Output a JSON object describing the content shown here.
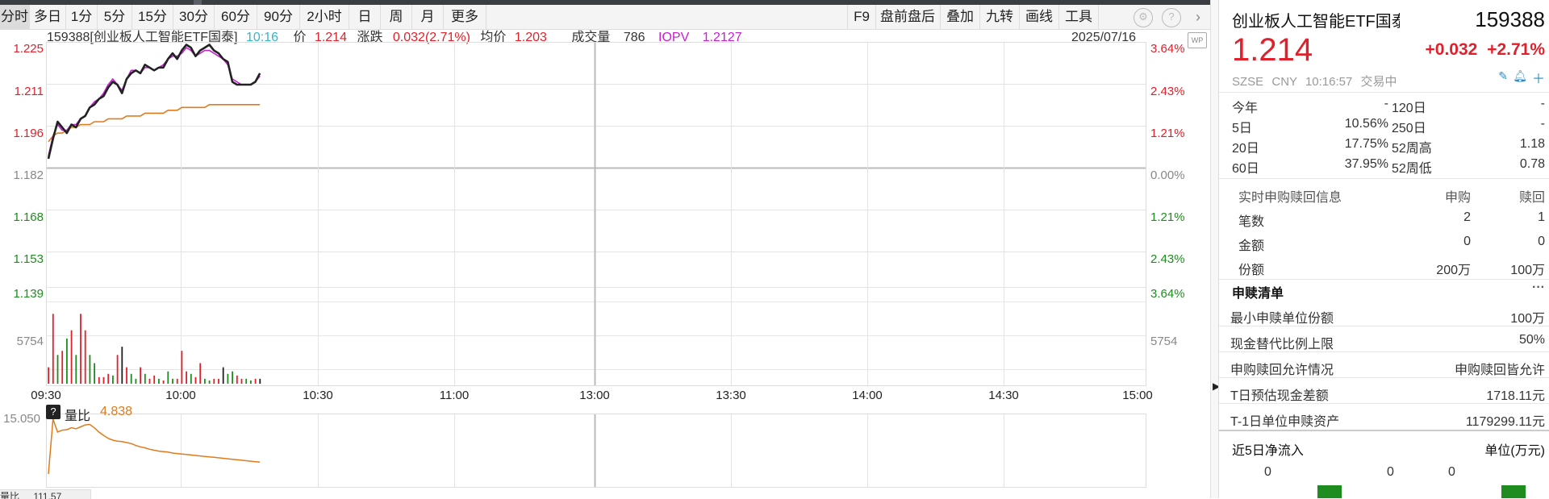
{
  "toolbar": {
    "tabs": [
      "分时",
      "多日",
      "1分",
      "5分",
      "15分",
      "30分",
      "60分",
      "90分",
      "2小时",
      "日",
      "周",
      "月",
      "更多"
    ],
    "active_tab": "分时",
    "right_buttons": [
      "F9",
      "盘前盘后",
      "叠加",
      "九转",
      "画线",
      "工具"
    ],
    "icons": [
      "gear-icon",
      "help-icon",
      "chevron-right-icon"
    ]
  },
  "info": {
    "code_name": "159388[创业板人工智能ETF国泰]",
    "time": "10:16",
    "price_label": "价",
    "price": "1.214",
    "change_label": "涨跌",
    "change": "0.032(2.71%)",
    "avg_label": "均价",
    "avg": "1.203",
    "volume_label": "成交量",
    "volume": "786",
    "iopv_label": "IOPV",
    "iopv": "1.2127",
    "date": "2025/07/16",
    "wp_icon": "WP"
  },
  "chart_data": {
    "type": "line",
    "title": "",
    "price_axis_left": [
      "1.225",
      "1.211",
      "1.196",
      "1.182",
      "1.168",
      "1.153",
      "1.139"
    ],
    "price_axis_right": [
      "3.64%",
      "2.43%",
      "1.21%",
      "0.00%",
      "1.21%",
      "2.43%",
      "3.64%"
    ],
    "volume_axis": "5754",
    "x_ticks": [
      "09:30",
      "10:00",
      "10:30",
      "11:00",
      "13:00",
      "13:30",
      "14:00",
      "14:30",
      "15:00"
    ],
    "ylim": [
      1.139,
      1.225
    ],
    "prev_close": 1.182,
    "series": [
      {
        "name": "价",
        "color": "#222222",
        "x": [
          0,
          1,
          2,
          3,
          4,
          5,
          6,
          7,
          8,
          9,
          10,
          11,
          12,
          13,
          14,
          15,
          16,
          17,
          18,
          19,
          20,
          21,
          22,
          23,
          24,
          25,
          26,
          27,
          28,
          29,
          30,
          31,
          32,
          33,
          34,
          35,
          36,
          37,
          38,
          39,
          40,
          41,
          42,
          43,
          44,
          45,
          46
        ],
        "values": [
          1.184,
          1.191,
          1.197,
          1.195,
          1.193,
          1.196,
          1.195,
          1.198,
          1.199,
          1.202,
          1.203,
          1.205,
          1.206,
          1.209,
          1.211,
          1.21,
          1.207,
          1.212,
          1.214,
          1.215,
          1.214,
          1.217,
          1.216,
          1.215,
          1.216,
          1.216,
          1.219,
          1.221,
          1.219,
          1.222,
          1.224,
          1.223,
          1.22,
          1.222,
          1.223,
          1.224,
          1.222,
          1.221,
          1.219,
          1.218,
          1.211,
          1.21,
          1.21,
          1.21,
          1.21,
          1.211,
          1.214
        ]
      },
      {
        "name": "IOPV",
        "color": "#c61ed1",
        "x": [
          0,
          1,
          2,
          3,
          4,
          5,
          6,
          7,
          8,
          9,
          10,
          11,
          12,
          13,
          14,
          15,
          16,
          17,
          18,
          19,
          20,
          21,
          22,
          23,
          24,
          25,
          26,
          27,
          28,
          29,
          30,
          31,
          32,
          33,
          34,
          35,
          36,
          37,
          38,
          39,
          40,
          41,
          42,
          43,
          44,
          45,
          46
        ],
        "values": [
          1.185,
          1.192,
          1.196,
          1.194,
          1.194,
          1.196,
          1.196,
          1.198,
          1.199,
          1.202,
          1.204,
          1.205,
          1.207,
          1.21,
          1.212,
          1.21,
          1.208,
          1.212,
          1.215,
          1.215,
          1.214,
          1.216,
          1.216,
          1.215,
          1.216,
          1.217,
          1.219,
          1.22,
          1.22,
          1.221,
          1.223,
          1.222,
          1.22,
          1.221,
          1.222,
          1.222,
          1.221,
          1.22,
          1.219,
          1.217,
          1.212,
          1.211,
          1.21,
          1.21,
          1.21,
          1.211,
          1.213
        ]
      },
      {
        "name": "均价",
        "color": "#e07b1d",
        "x": [
          0,
          1,
          2,
          3,
          4,
          5,
          6,
          7,
          8,
          9,
          10,
          11,
          12,
          13,
          14,
          15,
          16,
          17,
          18,
          19,
          20,
          21,
          22,
          23,
          24,
          25,
          26,
          27,
          28,
          29,
          30,
          31,
          32,
          33,
          34,
          35,
          36,
          37,
          38,
          39,
          40,
          41,
          42,
          43,
          44,
          45,
          46
        ],
        "values": [
          1.19,
          1.192,
          1.193,
          1.193,
          1.194,
          1.195,
          1.195,
          1.196,
          1.196,
          1.196,
          1.197,
          1.197,
          1.197,
          1.198,
          1.198,
          1.198,
          1.198,
          1.199,
          1.199,
          1.199,
          1.199,
          1.2,
          1.2,
          1.2,
          1.2,
          1.2,
          1.201,
          1.201,
          1.201,
          1.202,
          1.202,
          1.202,
          1.202,
          1.202,
          1.202,
          1.203,
          1.203,
          1.203,
          1.203,
          1.203,
          1.203,
          1.203,
          1.203,
          1.203,
          1.203,
          1.203,
          1.203
        ]
      }
    ],
    "volume_bars": [
      0.2,
      0.85,
      0.35,
      0.4,
      0.55,
      0.65,
      0.35,
      0.85,
      0.65,
      0.35,
      0.25,
      0.08,
      0.08,
      0.12,
      0.1,
      0.35,
      0.45,
      0.2,
      0.12,
      0.06,
      0.2,
      0.12,
      0.06,
      0.1,
      0.06,
      0.04,
      0.15,
      0.06,
      0.06,
      0.4,
      0.15,
      0.12,
      0.08,
      0.25,
      0.06,
      0.04,
      0.06,
      0.06,
      0.2,
      0.12,
      0.15,
      0.1,
      0.06,
      0.06,
      0.04,
      0.06,
      0.06
    ],
    "volume_colors": [
      "r",
      "r",
      "g",
      "r",
      "g",
      "r",
      "g",
      "r",
      "r",
      "g",
      "g",
      "r",
      "r",
      "r",
      "g",
      "r",
      "k",
      "r",
      "g",
      "g",
      "r",
      "g",
      "r",
      "r",
      "g",
      "r",
      "g",
      "g",
      "r",
      "r",
      "r",
      "g",
      "r",
      "r",
      "g",
      "g",
      "r",
      "r",
      "k",
      "g",
      "g",
      "r",
      "r",
      "g",
      "g",
      "r",
      "k"
    ],
    "ratio_label": "量比",
    "ratio_value": "4.838",
    "ratio_axis": "15.050",
    "ratio_values": [
      0,
      14.2,
      11.5,
      11.9,
      12.0,
      12.4,
      12.2,
      12.6,
      13.0,
      13.1,
      12.4,
      11.5,
      10.8,
      10.2,
      9.8,
      9.6,
      9.5,
      9.3,
      9.1,
      8.7,
      8.4,
      8.2,
      7.9,
      7.7,
      7.5,
      7.4,
      7.3,
      7.1,
      7.0,
      6.9,
      6.8,
      6.7,
      6.6,
      6.5,
      6.4,
      6.3,
      6.2,
      6.1,
      6.0,
      5.9,
      5.8,
      5.7,
      5.6,
      5.5,
      5.4,
      5.3,
      5.2
    ]
  },
  "bottom_tab": {
    "label": "量比",
    "value": "111.57"
  },
  "panel": {
    "name": "创业板人工智能ETF国泰",
    "code": "159388",
    "price": "1.214",
    "change": "+0.032",
    "change_pct": "+2.71%",
    "exchange": "SZSE",
    "currency": "CNY",
    "time": "10:16:57",
    "status": "交易中",
    "stats": [
      {
        "l1": "今年",
        "v1": "-",
        "l2": "120日",
        "v2": "-"
      },
      {
        "l1": "5日",
        "v1": "10.56%",
        "l2": "250日",
        "v2": "-"
      },
      {
        "l1": "20日",
        "v1": "17.75%",
        "l2": "52周高",
        "v2": "1.18"
      },
      {
        "l1": "60日",
        "v1": "37.95%",
        "l2": "52周低",
        "v2": "0.78"
      }
    ],
    "redeem_header": [
      "实时申购赎回信息",
      "申购",
      "赎回"
    ],
    "redeem_rows": [
      {
        "label": "笔数",
        "buy": "2",
        "sell": "1"
      },
      {
        "label": "金额",
        "buy": "0",
        "sell": "0"
      },
      {
        "label": "份额",
        "buy": "200万",
        "sell": "100万"
      }
    ],
    "list_title": "申赎清单",
    "list_more": "···",
    "list_rows": [
      {
        "label": "最小申赎单位份额",
        "value": "100万"
      },
      {
        "label": "现金替代比例上限",
        "value": "50%"
      },
      {
        "label": "申购赎回允许情况",
        "value": "申购赎回皆允许"
      },
      {
        "label": "T日预估现金差额",
        "value": "1718.11元"
      },
      {
        "label": "T-1日单位申赎资产",
        "value": "1179299.11元"
      }
    ],
    "flow_title": "近5日净流入",
    "flow_unit": "单位(万元)",
    "flow_values": [
      "0",
      "0",
      "0"
    ]
  }
}
